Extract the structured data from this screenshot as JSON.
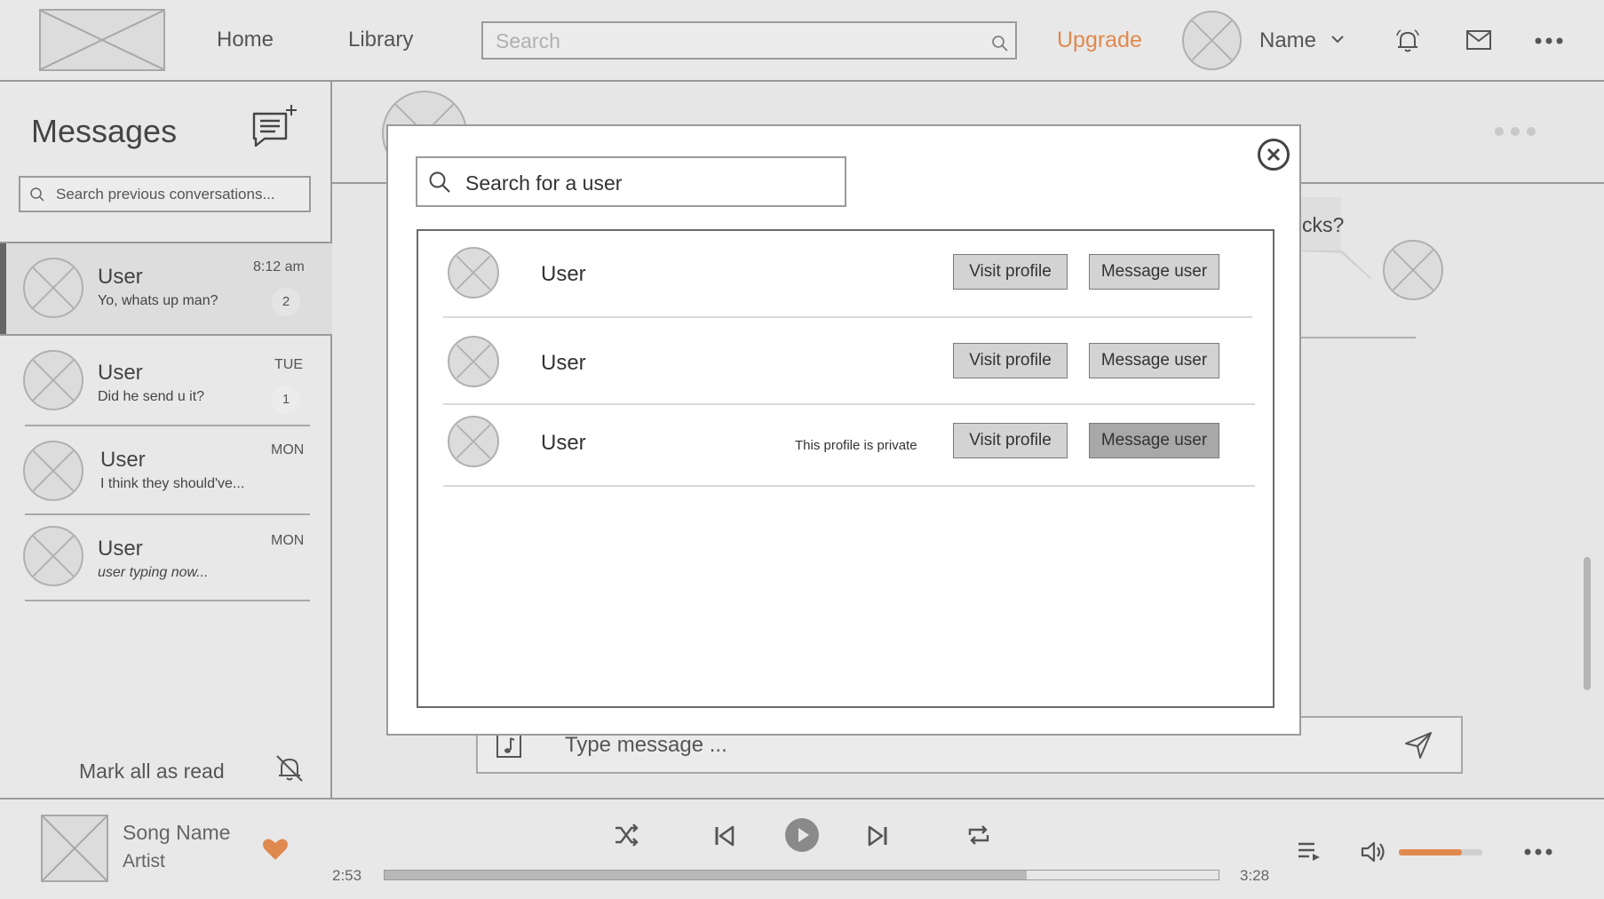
{
  "topbar": {
    "nav": [
      "Home",
      "Library"
    ],
    "search_placeholder": "Search",
    "upgrade_label": "Upgrade",
    "user_name": "Name"
  },
  "sidebar": {
    "title": "Messages",
    "search_placeholder": "Search previous conversations...",
    "conversations": [
      {
        "name": "User",
        "preview": "Yo, whats up man?",
        "time": "8:12 am",
        "unread": "2",
        "active": true
      },
      {
        "name": "User",
        "preview": "Did he send u it?",
        "time": "TUE",
        "unread": "1",
        "active": false
      },
      {
        "name": "User",
        "preview": "I think they should've...",
        "time": "MON",
        "unread": "",
        "active": false
      },
      {
        "name": "User",
        "preview": "user typing now...",
        "time": "MON",
        "unread": "",
        "active": false
      }
    ],
    "mark_all_read": "Mark all as read"
  },
  "chat": {
    "bubble_fragment": "cks?",
    "compose_placeholder": "Type message ..."
  },
  "modal": {
    "search_placeholder": "Search for a user",
    "results": [
      {
        "name": "User",
        "note": "",
        "visit_label": "Visit profile",
        "message_label": "Message user",
        "message_disabled": false
      },
      {
        "name": "User",
        "note": "",
        "visit_label": "Visit profile",
        "message_label": "Message user",
        "message_disabled": false
      },
      {
        "name": "User",
        "note": "This profile is private",
        "visit_label": "Visit profile",
        "message_label": "Message user",
        "message_disabled": true
      }
    ]
  },
  "player": {
    "song_name": "Song Name",
    "artist": "Artist",
    "elapsed": "2:53",
    "duration": "3:28",
    "progress": 0.77,
    "volume": 0.75,
    "accent_color": "#e0894f"
  }
}
